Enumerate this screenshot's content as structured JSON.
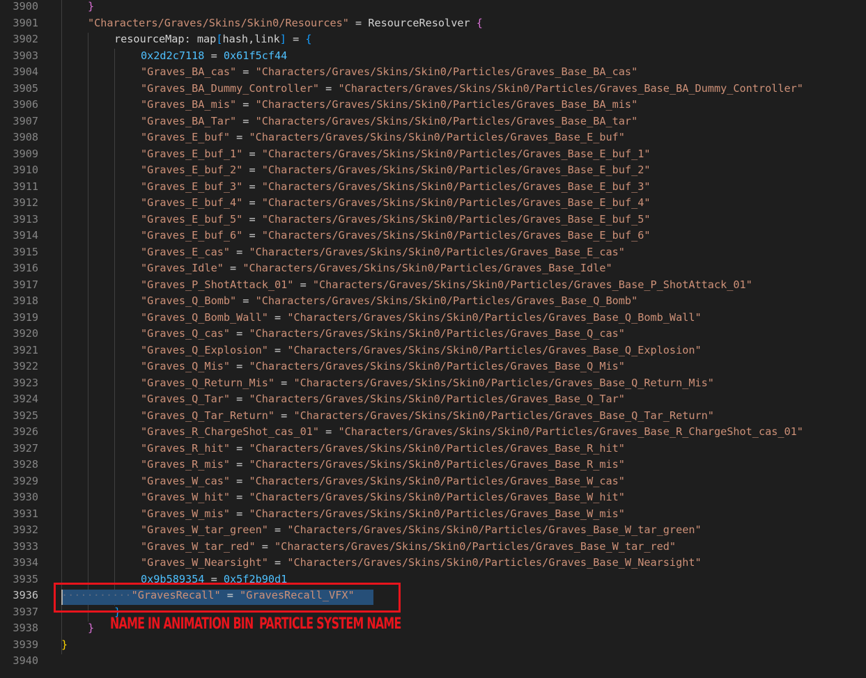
{
  "editor": {
    "first_line_number": 3900,
    "active_line_number": 3936,
    "lines": [
      {
        "num": "3900",
        "indent": 1,
        "tokens": [
          {
            "t": "}",
            "c": "b2"
          }
        ]
      },
      {
        "num": "3901",
        "indent": 1,
        "tokens": [
          {
            "t": "\"Characters/Graves/Skins/Skin0/Resources\"",
            "c": "str"
          },
          {
            "t": " = ",
            "c": "op"
          },
          {
            "t": "ResourceResolver",
            "c": "plain"
          },
          {
            "t": " ",
            "c": "op"
          },
          {
            "t": "{",
            "c": "b2"
          }
        ]
      },
      {
        "num": "3902",
        "indent": 2,
        "tokens": [
          {
            "t": "resourceMap",
            "c": "plain"
          },
          {
            "t": ": ",
            "c": "op"
          },
          {
            "t": "map",
            "c": "plain"
          },
          {
            "t": "[",
            "c": "b3"
          },
          {
            "t": "hash",
            "c": "plain"
          },
          {
            "t": ",",
            "c": "op"
          },
          {
            "t": "link",
            "c": "plain"
          },
          {
            "t": "]",
            "c": "b3"
          },
          {
            "t": " = ",
            "c": "op"
          },
          {
            "t": "{",
            "c": "b3"
          }
        ]
      },
      {
        "num": "3903",
        "indent": 3,
        "tokens": [
          {
            "t": "0x2d2c7118",
            "c": "hex"
          },
          {
            "t": " = ",
            "c": "op"
          },
          {
            "t": "0x61f5cf44",
            "c": "hex"
          }
        ]
      },
      {
        "num": "3904",
        "indent": 3,
        "tokens": [
          {
            "t": "\"Graves_BA_cas\"",
            "c": "str"
          },
          {
            "t": " = ",
            "c": "op"
          },
          {
            "t": "\"Characters/Graves/Skins/Skin0/Particles/Graves_Base_BA_cas\"",
            "c": "str"
          }
        ]
      },
      {
        "num": "3905",
        "indent": 3,
        "tokens": [
          {
            "t": "\"Graves_BA_Dummy_Controller\"",
            "c": "str"
          },
          {
            "t": " = ",
            "c": "op"
          },
          {
            "t": "\"Characters/Graves/Skins/Skin0/Particles/Graves_Base_BA_Dummy_Controller\"",
            "c": "str"
          }
        ]
      },
      {
        "num": "3906",
        "indent": 3,
        "tokens": [
          {
            "t": "\"Graves_BA_mis\"",
            "c": "str"
          },
          {
            "t": " = ",
            "c": "op"
          },
          {
            "t": "\"Characters/Graves/Skins/Skin0/Particles/Graves_Base_BA_mis\"",
            "c": "str"
          }
        ]
      },
      {
        "num": "3907",
        "indent": 3,
        "tokens": [
          {
            "t": "\"Graves_BA_Tar\"",
            "c": "str"
          },
          {
            "t": " = ",
            "c": "op"
          },
          {
            "t": "\"Characters/Graves/Skins/Skin0/Particles/Graves_Base_BA_tar\"",
            "c": "str"
          }
        ]
      },
      {
        "num": "3908",
        "indent": 3,
        "tokens": [
          {
            "t": "\"Graves_E_buf\"",
            "c": "str"
          },
          {
            "t": " = ",
            "c": "op"
          },
          {
            "t": "\"Characters/Graves/Skins/Skin0/Particles/Graves_Base_E_buf\"",
            "c": "str"
          }
        ]
      },
      {
        "num": "3909",
        "indent": 3,
        "tokens": [
          {
            "t": "\"Graves_E_buf_1\"",
            "c": "str"
          },
          {
            "t": " = ",
            "c": "op"
          },
          {
            "t": "\"Characters/Graves/Skins/Skin0/Particles/Graves_Base_E_buf_1\"",
            "c": "str"
          }
        ]
      },
      {
        "num": "3910",
        "indent": 3,
        "tokens": [
          {
            "t": "\"Graves_E_buf_2\"",
            "c": "str"
          },
          {
            "t": " = ",
            "c": "op"
          },
          {
            "t": "\"Characters/Graves/Skins/Skin0/Particles/Graves_Base_E_buf_2\"",
            "c": "str"
          }
        ]
      },
      {
        "num": "3911",
        "indent": 3,
        "tokens": [
          {
            "t": "\"Graves_E_buf_3\"",
            "c": "str"
          },
          {
            "t": " = ",
            "c": "op"
          },
          {
            "t": "\"Characters/Graves/Skins/Skin0/Particles/Graves_Base_E_buf_3\"",
            "c": "str"
          }
        ]
      },
      {
        "num": "3912",
        "indent": 3,
        "tokens": [
          {
            "t": "\"Graves_E_buf_4\"",
            "c": "str"
          },
          {
            "t": " = ",
            "c": "op"
          },
          {
            "t": "\"Characters/Graves/Skins/Skin0/Particles/Graves_Base_E_buf_4\"",
            "c": "str"
          }
        ]
      },
      {
        "num": "3913",
        "indent": 3,
        "tokens": [
          {
            "t": "\"Graves_E_buf_5\"",
            "c": "str"
          },
          {
            "t": " = ",
            "c": "op"
          },
          {
            "t": "\"Characters/Graves/Skins/Skin0/Particles/Graves_Base_E_buf_5\"",
            "c": "str"
          }
        ]
      },
      {
        "num": "3914",
        "indent": 3,
        "tokens": [
          {
            "t": "\"Graves_E_buf_6\"",
            "c": "str"
          },
          {
            "t": " = ",
            "c": "op"
          },
          {
            "t": "\"Characters/Graves/Skins/Skin0/Particles/Graves_Base_E_buf_6\"",
            "c": "str"
          }
        ]
      },
      {
        "num": "3915",
        "indent": 3,
        "tokens": [
          {
            "t": "\"Graves_E_cas\"",
            "c": "str"
          },
          {
            "t": " = ",
            "c": "op"
          },
          {
            "t": "\"Characters/Graves/Skins/Skin0/Particles/Graves_Base_E_cas\"",
            "c": "str"
          }
        ]
      },
      {
        "num": "3916",
        "indent": 3,
        "tokens": [
          {
            "t": "\"Graves_Idle\"",
            "c": "str"
          },
          {
            "t": " = ",
            "c": "op"
          },
          {
            "t": "\"Characters/Graves/Skins/Skin0/Particles/Graves_Base_Idle\"",
            "c": "str"
          }
        ]
      },
      {
        "num": "3917",
        "indent": 3,
        "tokens": [
          {
            "t": "\"Graves_P_ShotAttack_01\"",
            "c": "str"
          },
          {
            "t": " = ",
            "c": "op"
          },
          {
            "t": "\"Characters/Graves/Skins/Skin0/Particles/Graves_Base_P_ShotAttack_01\"",
            "c": "str"
          }
        ]
      },
      {
        "num": "3918",
        "indent": 3,
        "tokens": [
          {
            "t": "\"Graves_Q_Bomb\"",
            "c": "str"
          },
          {
            "t": " = ",
            "c": "op"
          },
          {
            "t": "\"Characters/Graves/Skins/Skin0/Particles/Graves_Base_Q_Bomb\"",
            "c": "str"
          }
        ]
      },
      {
        "num": "3919",
        "indent": 3,
        "tokens": [
          {
            "t": "\"Graves_Q_Bomb_Wall\"",
            "c": "str"
          },
          {
            "t": " = ",
            "c": "op"
          },
          {
            "t": "\"Characters/Graves/Skins/Skin0/Particles/Graves_Base_Q_Bomb_Wall\"",
            "c": "str"
          }
        ]
      },
      {
        "num": "3920",
        "indent": 3,
        "tokens": [
          {
            "t": "\"Graves_Q_cas\"",
            "c": "str"
          },
          {
            "t": " = ",
            "c": "op"
          },
          {
            "t": "\"Characters/Graves/Skins/Skin0/Particles/Graves_Base_Q_cas\"",
            "c": "str"
          }
        ]
      },
      {
        "num": "3921",
        "indent": 3,
        "tokens": [
          {
            "t": "\"Graves_Q_Explosion\"",
            "c": "str"
          },
          {
            "t": " = ",
            "c": "op"
          },
          {
            "t": "\"Characters/Graves/Skins/Skin0/Particles/Graves_Base_Q_Explosion\"",
            "c": "str"
          }
        ]
      },
      {
        "num": "3922",
        "indent": 3,
        "tokens": [
          {
            "t": "\"Graves_Q_Mis\"",
            "c": "str"
          },
          {
            "t": " = ",
            "c": "op"
          },
          {
            "t": "\"Characters/Graves/Skins/Skin0/Particles/Graves_Base_Q_Mis\"",
            "c": "str"
          }
        ]
      },
      {
        "num": "3923",
        "indent": 3,
        "tokens": [
          {
            "t": "\"Graves_Q_Return_Mis\"",
            "c": "str"
          },
          {
            "t": " = ",
            "c": "op"
          },
          {
            "t": "\"Characters/Graves/Skins/Skin0/Particles/Graves_Base_Q_Return_Mis\"",
            "c": "str"
          }
        ]
      },
      {
        "num": "3924",
        "indent": 3,
        "tokens": [
          {
            "t": "\"Graves_Q_Tar\"",
            "c": "str"
          },
          {
            "t": " = ",
            "c": "op"
          },
          {
            "t": "\"Characters/Graves/Skins/Skin0/Particles/Graves_Base_Q_Tar\"",
            "c": "str"
          }
        ]
      },
      {
        "num": "3925",
        "indent": 3,
        "tokens": [
          {
            "t": "\"Graves_Q_Tar_Return\"",
            "c": "str"
          },
          {
            "t": " = ",
            "c": "op"
          },
          {
            "t": "\"Characters/Graves/Skins/Skin0/Particles/Graves_Base_Q_Tar_Return\"",
            "c": "str"
          }
        ]
      },
      {
        "num": "3926",
        "indent": 3,
        "tokens": [
          {
            "t": "\"Graves_R_ChargeShot_cas_01\"",
            "c": "str"
          },
          {
            "t": " = ",
            "c": "op"
          },
          {
            "t": "\"Characters/Graves/Skins/Skin0/Particles/Graves_Base_R_ChargeShot_cas_01\"",
            "c": "str"
          }
        ]
      },
      {
        "num": "3927",
        "indent": 3,
        "tokens": [
          {
            "t": "\"Graves_R_hit\"",
            "c": "str"
          },
          {
            "t": " = ",
            "c": "op"
          },
          {
            "t": "\"Characters/Graves/Skins/Skin0/Particles/Graves_Base_R_hit\"",
            "c": "str"
          }
        ]
      },
      {
        "num": "3928",
        "indent": 3,
        "tokens": [
          {
            "t": "\"Graves_R_mis\"",
            "c": "str"
          },
          {
            "t": " = ",
            "c": "op"
          },
          {
            "t": "\"Characters/Graves/Skins/Skin0/Particles/Graves_Base_R_mis\"",
            "c": "str"
          }
        ]
      },
      {
        "num": "3929",
        "indent": 3,
        "tokens": [
          {
            "t": "\"Graves_W_cas\"",
            "c": "str"
          },
          {
            "t": " = ",
            "c": "op"
          },
          {
            "t": "\"Characters/Graves/Skins/Skin0/Particles/Graves_Base_W_cas\"",
            "c": "str"
          }
        ]
      },
      {
        "num": "3930",
        "indent": 3,
        "tokens": [
          {
            "t": "\"Graves_W_hit\"",
            "c": "str"
          },
          {
            "t": " = ",
            "c": "op"
          },
          {
            "t": "\"Characters/Graves/Skins/Skin0/Particles/Graves_Base_W_hit\"",
            "c": "str"
          }
        ]
      },
      {
        "num": "3931",
        "indent": 3,
        "tokens": [
          {
            "t": "\"Graves_W_mis\"",
            "c": "str"
          },
          {
            "t": " = ",
            "c": "op"
          },
          {
            "t": "\"Characters/Graves/Skins/Skin0/Particles/Graves_Base_W_mis\"",
            "c": "str"
          }
        ]
      },
      {
        "num": "3932",
        "indent": 3,
        "tokens": [
          {
            "t": "\"Graves_W_tar_green\"",
            "c": "str"
          },
          {
            "t": " = ",
            "c": "op"
          },
          {
            "t": "\"Characters/Graves/Skins/Skin0/Particles/Graves_Base_W_tar_green\"",
            "c": "str"
          }
        ]
      },
      {
        "num": "3933",
        "indent": 3,
        "tokens": [
          {
            "t": "\"Graves_W_tar_red\"",
            "c": "str"
          },
          {
            "t": " = ",
            "c": "op"
          },
          {
            "t": "\"Characters/Graves/Skins/Skin0/Particles/Graves_Base_W_tar_red\"",
            "c": "str"
          }
        ]
      },
      {
        "num": "3934",
        "indent": 3,
        "tokens": [
          {
            "t": "\"Graves_W_Nearsight\"",
            "c": "str"
          },
          {
            "t": " = ",
            "c": "op"
          },
          {
            "t": "\"Characters/Graves/Skins/Skin0/Particles/Graves_Base_W_Nearsight\"",
            "c": "str"
          }
        ]
      },
      {
        "num": "3935",
        "indent": 3,
        "tokens": [
          {
            "t": "0x9b589354",
            "c": "hex"
          },
          {
            "t": " = ",
            "c": "op"
          },
          {
            "t": "0x5f2b90d1",
            "c": "hex"
          }
        ]
      },
      {
        "num": "3936",
        "indent": 0,
        "ws_dots": "···········",
        "tokens": [
          {
            "t": "\"GravesRecall\"",
            "c": "str"
          },
          {
            "t": " = ",
            "c": "op"
          },
          {
            "t": "\"GravesRecall_VFX\"",
            "c": "str"
          }
        ]
      },
      {
        "num": "3937",
        "indent": 2,
        "tokens": [
          {
            "t": "}",
            "c": "b3"
          }
        ]
      },
      {
        "num": "3938",
        "indent": 1,
        "tokens": [
          {
            "t": "}",
            "c": "b2"
          }
        ]
      },
      {
        "num": "3939",
        "indent": 0,
        "tokens": [
          {
            "t": "}",
            "c": "b1"
          }
        ]
      },
      {
        "num": "3940",
        "indent": 0,
        "tokens": []
      }
    ]
  },
  "annotations": {
    "label_left": "NAME IN ANIMATION BIN",
    "label_right": "PARTICLE SYSTEM NAME",
    "color": "#e8141c"
  },
  "colors": {
    "background": "#1e1e1e",
    "string": "#ce9178",
    "hex": "#4fc1ff",
    "selection": "#264f78"
  }
}
